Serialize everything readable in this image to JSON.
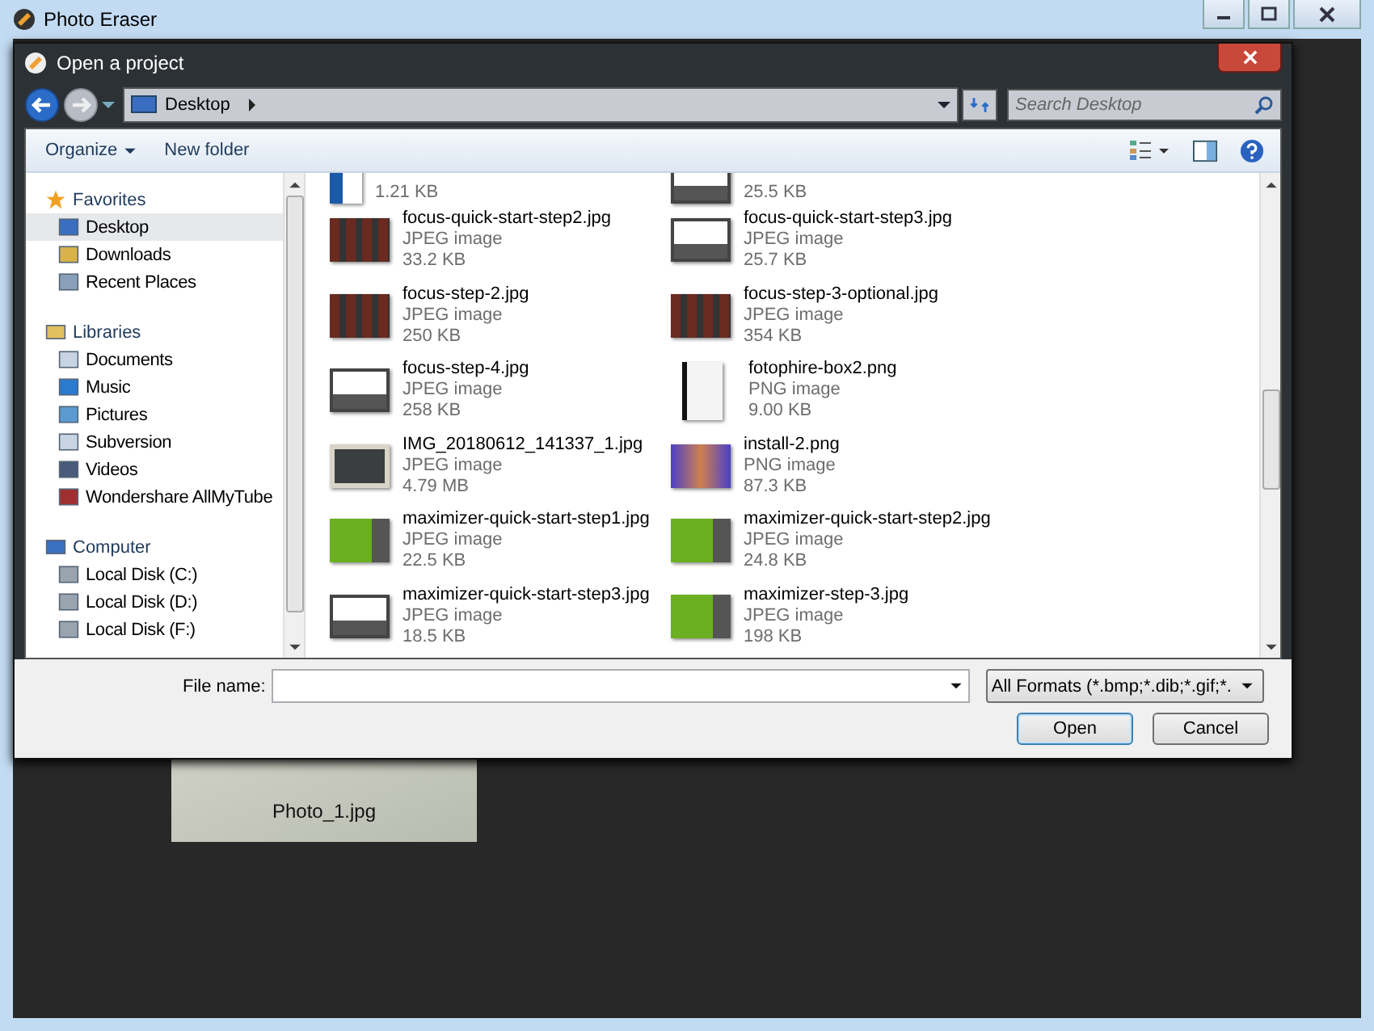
{
  "window": {
    "title": "Photo Eraser"
  },
  "background_card": {
    "label": "Photo_1.jpg"
  },
  "dialog": {
    "title": "Open a project",
    "address": {
      "location": "Desktop",
      "search_placeholder": "Search Desktop"
    },
    "toolbar": {
      "organize": "Organize",
      "new_folder": "New folder"
    },
    "sidebar": [
      {
        "label": "Favorites",
        "children": [
          {
            "label": "Desktop",
            "selected": true
          },
          {
            "label": "Downloads",
            "selected": false
          },
          {
            "label": "Recent Places",
            "selected": false
          }
        ]
      },
      {
        "label": "Libraries",
        "children": [
          {
            "label": "Documents",
            "selected": false
          },
          {
            "label": "Music",
            "selected": false
          },
          {
            "label": "Pictures",
            "selected": false
          },
          {
            "label": "Subversion",
            "selected": false
          },
          {
            "label": "Videos",
            "selected": false
          },
          {
            "label": "Wondershare AllMyTube",
            "selected": false
          }
        ]
      },
      {
        "label": "Computer",
        "children": [
          {
            "label": "Local Disk (C:)",
            "selected": false
          },
          {
            "label": "Local Disk (D:)",
            "selected": false
          },
          {
            "label": "Local Disk (F:)",
            "selected": false
          }
        ]
      }
    ],
    "files": [
      {
        "size": "1.21 KB"
      },
      {
        "size": "25.5 KB"
      },
      {
        "name": "focus-quick-start-step2.jpg",
        "type": "JPEG image",
        "size": "33.2 KB"
      },
      {
        "name": "focus-quick-start-step3.jpg",
        "type": "JPEG image",
        "size": "25.7 KB"
      },
      {
        "name": "focus-step-2.jpg",
        "type": "JPEG image",
        "size": "250 KB"
      },
      {
        "name": "focus-step-3-optional.jpg",
        "type": "JPEG image",
        "size": "354 KB"
      },
      {
        "name": "focus-step-4.jpg",
        "type": "JPEG image",
        "size": "258 KB"
      },
      {
        "name": "fotophire-box2.png",
        "type": "PNG image",
        "size": "9.00 KB"
      },
      {
        "name": "IMG_20180612_141337_1.jpg",
        "type": "JPEG image",
        "size": "4.79 MB"
      },
      {
        "name": "install-2.png",
        "type": "PNG image",
        "size": "87.3 KB"
      },
      {
        "name": "maximizer-quick-start-step1.jpg",
        "type": "JPEG image",
        "size": "22.5 KB"
      },
      {
        "name": "maximizer-quick-start-step2.jpg",
        "type": "JPEG image",
        "size": "24.8 KB"
      },
      {
        "name": "maximizer-quick-start-step3.jpg",
        "type": "JPEG image",
        "size": "18.5 KB"
      },
      {
        "name": "maximizer-step-3.jpg",
        "type": "JPEG image",
        "size": "198 KB"
      }
    ],
    "file_name": {
      "label": "File name:"
    },
    "filter": "All Formats (*.bmp;*.dib;*.gif;*.",
    "buttons": [
      {
        "label": "Open",
        "kind": "default"
      },
      {
        "label": "Cancel",
        "kind": "normal"
      }
    ]
  }
}
